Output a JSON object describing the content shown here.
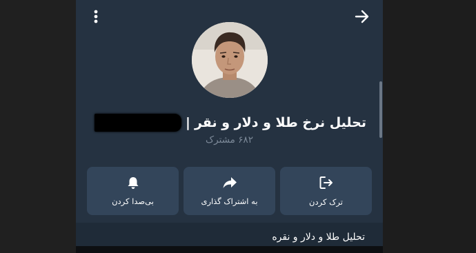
{
  "header": {
    "menu_icon": "more-vertical-icon",
    "back_icon": "arrow-right-icon"
  },
  "channel": {
    "avatar": "profile-photo",
    "title": "تحلیل نرخ طلا و دلار و نقر",
    "title_separator": "|",
    "subscribers": "۶۸۲ مشترک",
    "description": "تحلیل طلا و دلار و نقره"
  },
  "actions": [
    {
      "label": "بی‌صدا کردن",
      "icon": "bell-icon"
    },
    {
      "label": "به اشتراک گذاری",
      "icon": "share-icon"
    },
    {
      "label": "ترک کردن",
      "icon": "logout-icon"
    }
  ],
  "colors": {
    "panel": "#253241",
    "button": "#33455a",
    "muted_text": "#7d8a99",
    "section": "#1f2b38"
  }
}
